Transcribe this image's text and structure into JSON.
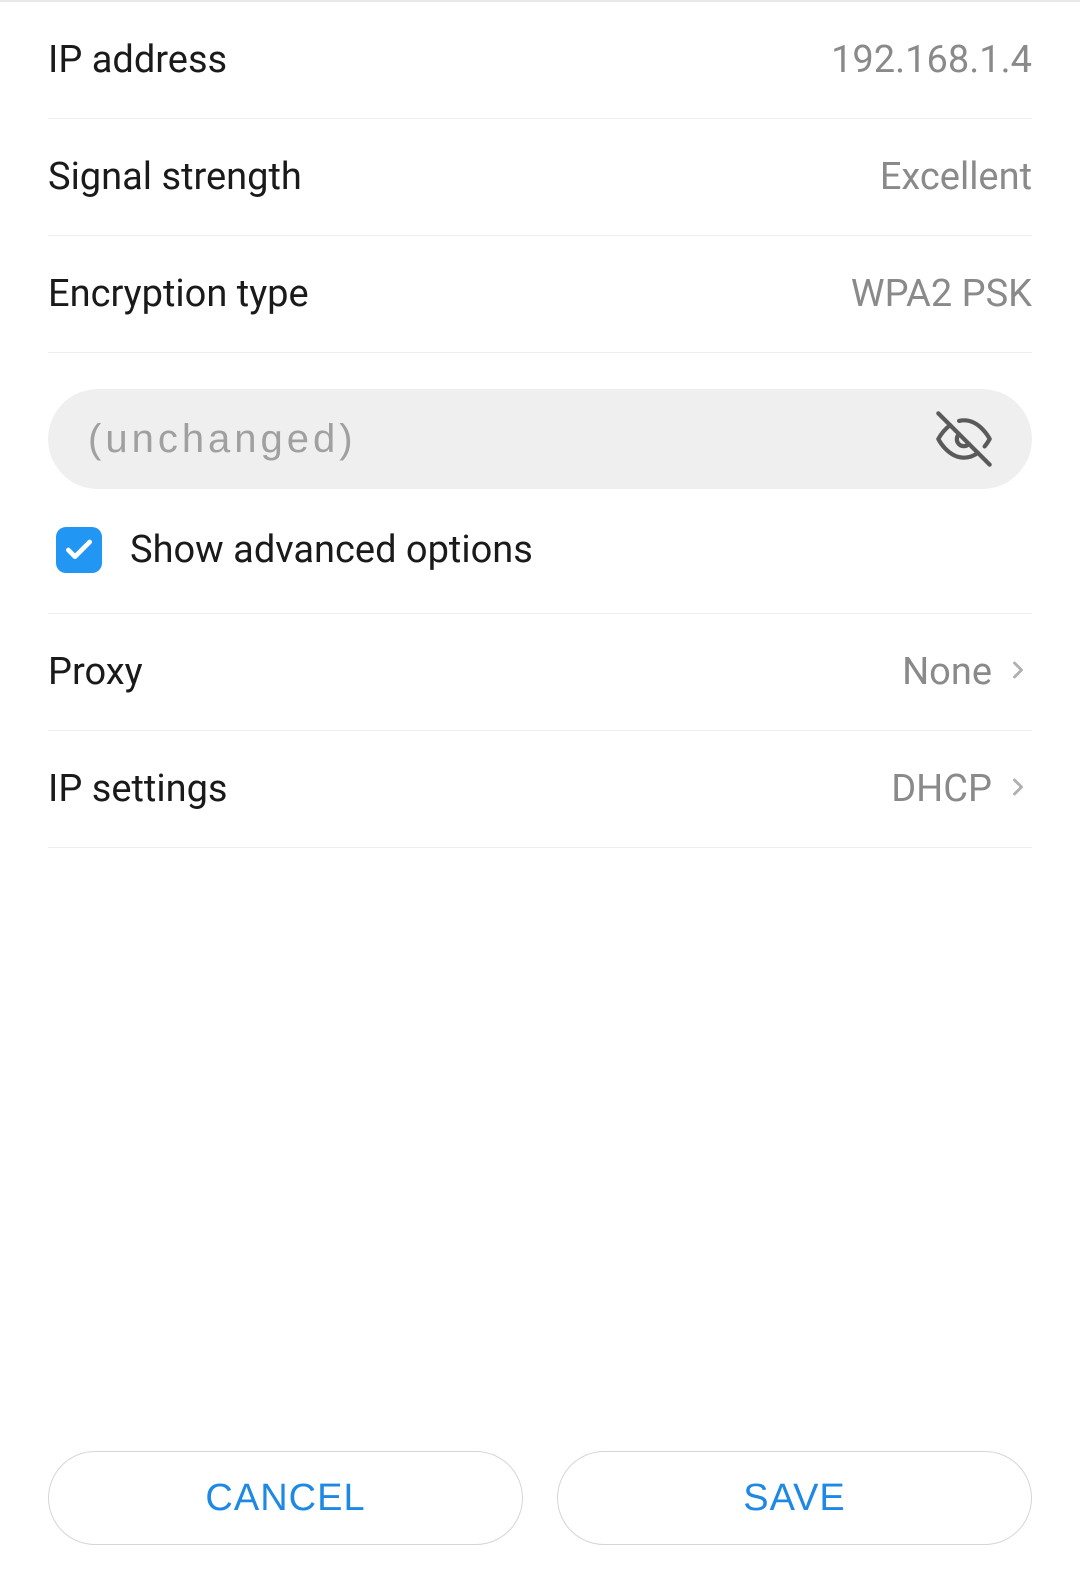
{
  "rows": {
    "ip_address": {
      "label": "IP address",
      "value": "192.168.1.4"
    },
    "signal_strength": {
      "label": "Signal strength",
      "value": "Excellent"
    },
    "encryption_type": {
      "label": "Encryption type",
      "value": "WPA2 PSK"
    }
  },
  "password": {
    "placeholder": "(unchanged)",
    "value": ""
  },
  "advanced": {
    "checked": true,
    "label": "Show advanced options"
  },
  "nav": {
    "proxy": {
      "label": "Proxy",
      "value": "None"
    },
    "ip_settings": {
      "label": "IP settings",
      "value": "DHCP"
    }
  },
  "buttons": {
    "cancel": "CANCEL",
    "save": "SAVE"
  }
}
